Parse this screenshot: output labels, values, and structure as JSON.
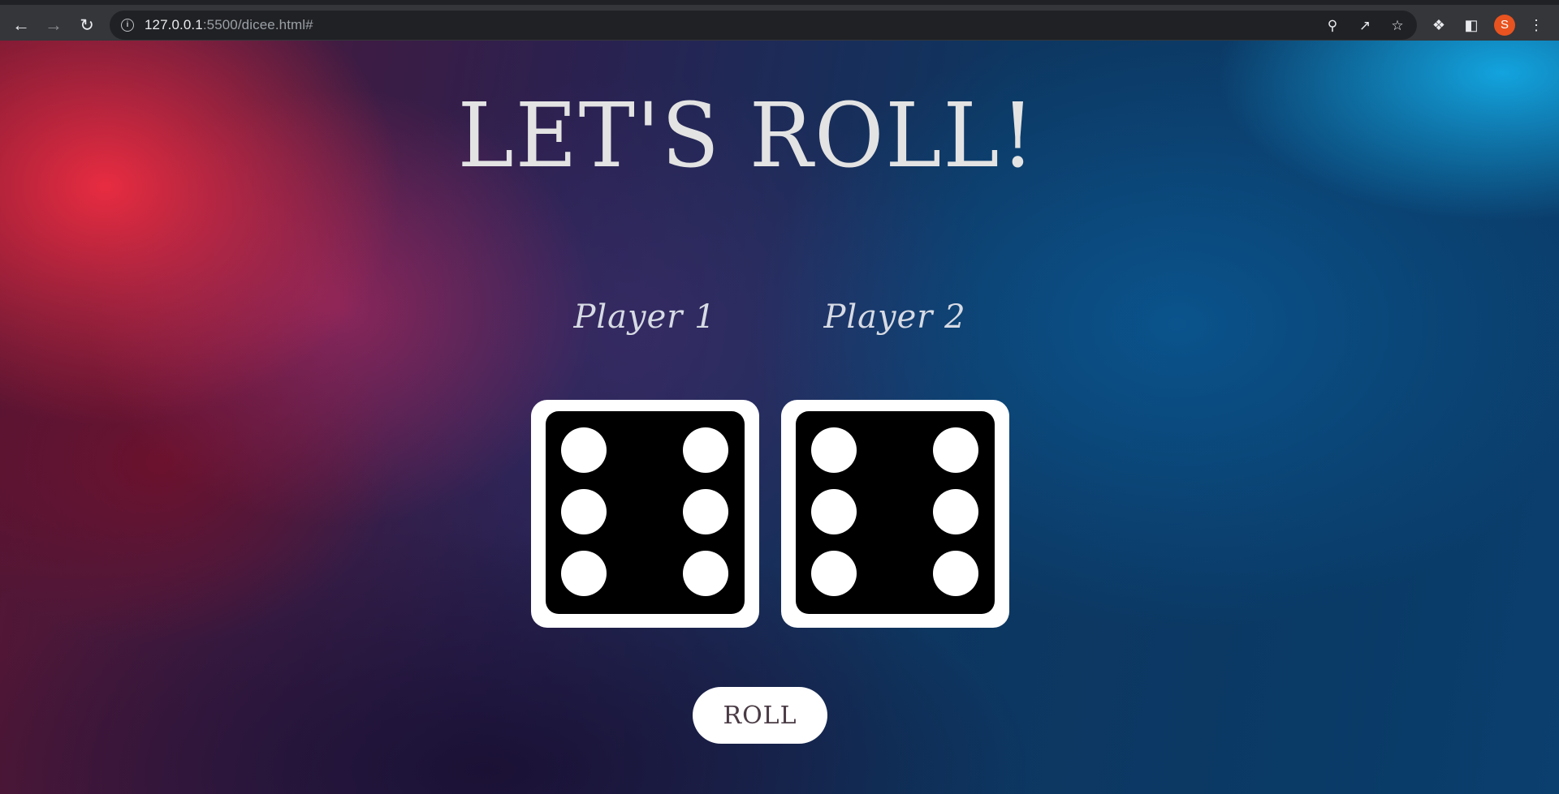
{
  "browser": {
    "url_host": "127.0.0.1",
    "url_rest": ":5500/dicee.html#",
    "profile_initial": "S"
  },
  "icons": {
    "back": "back-arrow-icon",
    "forward": "forward-arrow-icon",
    "reload": "reload-icon",
    "site_info": "info-icon",
    "zoom": "zoom-out-icon",
    "share": "share-icon",
    "bookmark": "star-icon",
    "extensions": "puzzle-icon",
    "side_panel": "side-panel-icon",
    "menu": "kebab-menu-icon"
  },
  "page": {
    "title": "LET'S ROLL!",
    "players": [
      {
        "label": "Player 1",
        "die_value": 6
      },
      {
        "label": "Player 2",
        "die_value": 6
      }
    ],
    "roll_button_label": "ROLL"
  },
  "colors": {
    "avatar": "#e8531f",
    "title_text": "#e3e3e3",
    "die_border": "#ffffff",
    "die_face": "#000000"
  }
}
